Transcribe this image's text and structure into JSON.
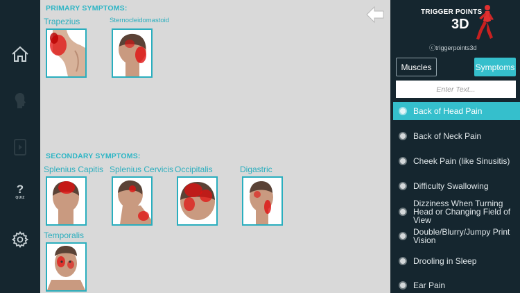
{
  "nav": {
    "quiz_label": "QUIZ",
    "quiz_glyph": "?"
  },
  "main": {
    "primary_title": "PRIMARY SYMPTOMS:",
    "secondary_title": "SECONDARY SYMPTOMS:",
    "primary": [
      {
        "name": "Trapezius",
        "view": "shoulder"
      },
      {
        "name": "Sternocleidomastoid",
        "view": "back-head"
      }
    ],
    "secondary": [
      {
        "name": "Splenius Capitis",
        "view": "back-head"
      },
      {
        "name": "Splenius Cervicis",
        "view": "back-head"
      },
      {
        "name": "Occipitalis",
        "view": "top-head"
      },
      {
        "name": "Digastric",
        "view": "side-head"
      },
      {
        "name": "Temporalis",
        "view": "face"
      }
    ]
  },
  "panel": {
    "logo_line1": "TRIGGER POINTS",
    "logo_line2": "3D",
    "handle": "ⓒtriggerpoints3d",
    "muscles_label": "Muscles",
    "symptoms_label": "Symptoms",
    "search_placeholder": "Enter Text...",
    "items": [
      {
        "label": "Back of Head Pain",
        "selected": true
      },
      {
        "label": "Back of Neck Pain",
        "selected": false
      },
      {
        "label": "Cheek Pain (like Sinusitis)",
        "selected": false
      },
      {
        "label": "Difficulty Swallowing",
        "selected": false
      },
      {
        "label": "Dizziness When Turning Head or Changing Field of View",
        "selected": false
      },
      {
        "label": "Double/Blurry/Jumpy Print Vision",
        "selected": false
      },
      {
        "label": "Drooling in Sleep",
        "selected": false
      },
      {
        "label": "Ear Pain",
        "selected": false
      }
    ]
  },
  "colors": {
    "accent": "#35bfcc",
    "label": "#2aaebe",
    "dark": "#15262f",
    "pain": "#e01010"
  }
}
